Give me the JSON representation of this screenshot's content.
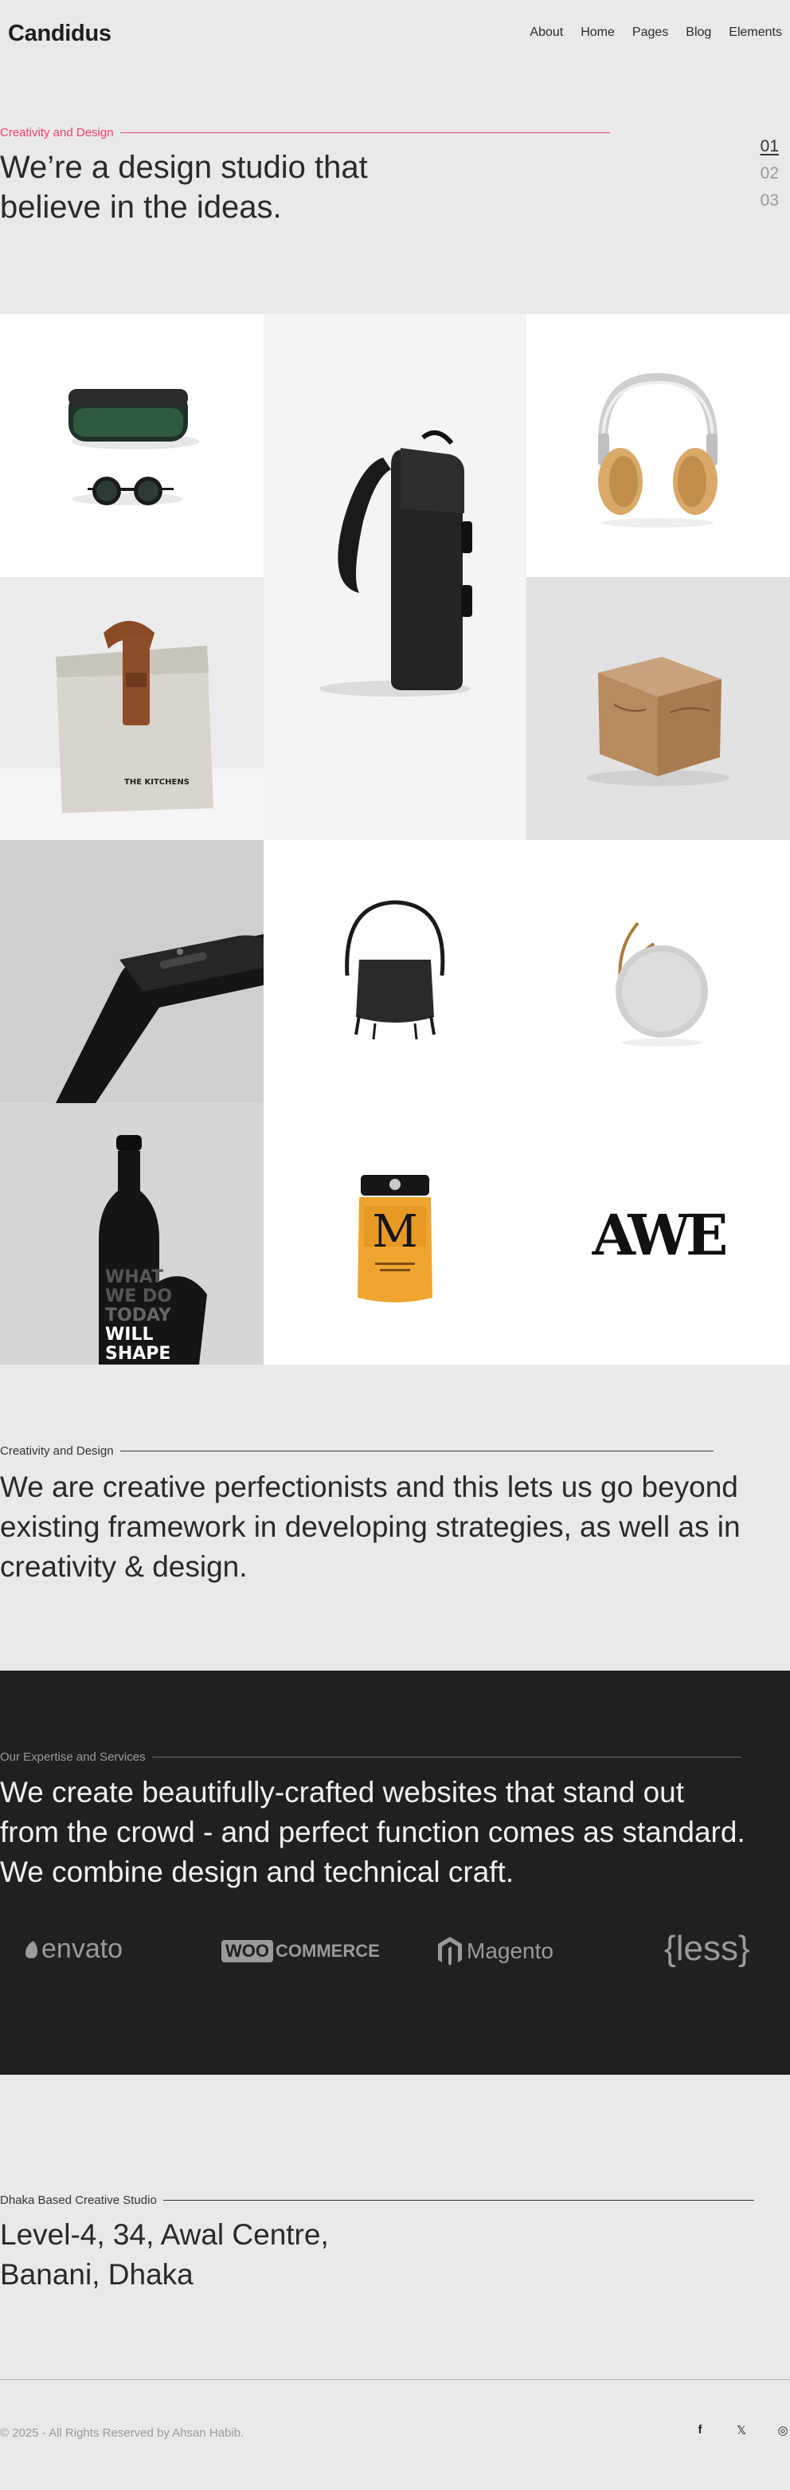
{
  "header": {
    "logo": "Candidus",
    "nav": [
      "About",
      "Home",
      "Pages",
      "Blog",
      "Elements"
    ]
  },
  "hero": {
    "kicker": "Creativity and Design",
    "title": "We’re a design studio that believe in the ideas.",
    "slides": [
      "01",
      "02",
      "03"
    ],
    "active_slide": 0
  },
  "gallery": {
    "bottle_text": "WHAT WE DO TODAY WILL SHAPE TOMO",
    "bag_label": "THE KITCHENS",
    "jar_letter": "M",
    "logo_tile_text": "AWE"
  },
  "intro": {
    "kicker": "Creativity and Design",
    "text": "We are creative perfectionists and this lets us go beyond existing framework in developing strategies, as well as in creativity & design."
  },
  "services": {
    "kicker": "Our Expertise and Services",
    "text": "We create beautifully-crafted websites that stand out from the crowd - and perfect function comes as standard. We combine design and technical craft.",
    "brands": [
      "envato",
      "WOO",
      "COMMERCE",
      "Magento",
      "{less}"
    ]
  },
  "contact": {
    "kicker": "Dhaka Based Creative Studio",
    "address": [
      "Level-4, 34, Awal Centre,",
      "Banani, Dhaka"
    ]
  },
  "footer": {
    "copyright": "© 2025 - All Rights Reserved by Ahsan Habib.",
    "social": [
      {
        "icon": "facebook-icon",
        "glyph": "f"
      },
      {
        "icon": "x-twitter-icon",
        "glyph": "𝕏"
      },
      {
        "icon": "instagram-icon",
        "glyph": "◎"
      }
    ]
  },
  "colors": {
    "accent": "#f1406a",
    "dark_section": "#202020",
    "page_bg": "#e9e9e9"
  }
}
